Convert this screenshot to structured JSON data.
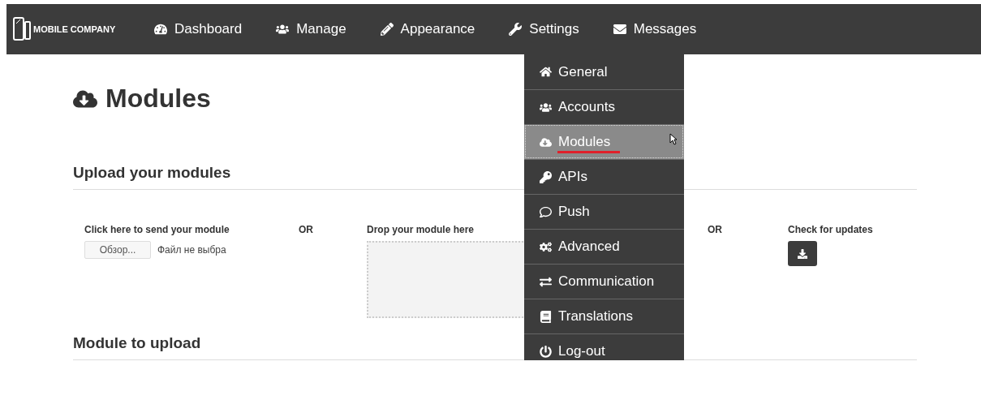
{
  "navbar": {
    "brand": "MOBILE COMPANY",
    "items": [
      {
        "label": "Dashboard"
      },
      {
        "label": "Manage"
      },
      {
        "label": "Appearance"
      },
      {
        "label": "Settings"
      },
      {
        "label": "Messages"
      }
    ]
  },
  "settings_menu": [
    {
      "label": "General",
      "selected": false
    },
    {
      "label": "Accounts",
      "selected": false
    },
    {
      "label": "Modules",
      "selected": true
    },
    {
      "label": "APIs",
      "selected": false
    },
    {
      "label": "Push",
      "selected": false
    },
    {
      "label": "Advanced",
      "selected": false
    },
    {
      "label": "Communication",
      "selected": false
    },
    {
      "label": "Translations",
      "selected": false
    },
    {
      "label": "Log-out",
      "selected": false
    }
  ],
  "page_title": "Modules",
  "upload_section": {
    "heading": "Upload your modules",
    "send_label": "Click here to send your module",
    "browse_button": "Обзор...",
    "file_status": "Файл не выбра",
    "or_1": "OR",
    "drop_label": "Drop your module here",
    "or_2": "OR",
    "updates_label": "Check for updates"
  },
  "module_section": {
    "heading": "Module to upload"
  }
}
